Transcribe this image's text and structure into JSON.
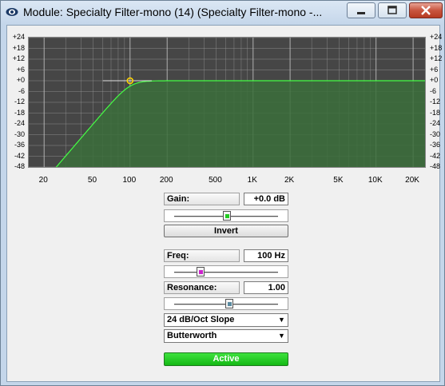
{
  "window": {
    "title": "Module: Specialty Filter-mono (14) (Specialty Filter-mono -...",
    "min_glyph": "—",
    "max_glyph": "□",
    "close_glyph": "✕"
  },
  "graph": {
    "db_labels": [
      "+24",
      "+18",
      "+12",
      "+6",
      "+0",
      "-6",
      "-12",
      "-18",
      "-24",
      "-30",
      "-36",
      "-42",
      "-48"
    ],
    "freq_labels": [
      "20",
      "50",
      "100",
      "200",
      "500",
      "1K",
      "2K",
      "5K",
      "10K",
      "20K"
    ],
    "colors": {
      "background": "#464646",
      "grid": "#9a9a9a",
      "fill": "#3b6e3b",
      "curve": "#44ff44",
      "handle": "#ffd400"
    }
  },
  "gain": {
    "label": "Gain:",
    "value": "+0.0 dB",
    "slider_fraction": 0.5,
    "thumb_color": "#22cc22"
  },
  "invert": {
    "label": "Invert"
  },
  "freq": {
    "label": "Freq:",
    "value": "100 Hz",
    "slider_fraction": 0.25,
    "thumb_color": "#cc22cc"
  },
  "resonance": {
    "label": "Resonance:",
    "value": "1.00",
    "slider_fraction": 0.52,
    "thumb_color": "#5a8aa0"
  },
  "slope": {
    "selected": "24 dB/Oct Slope"
  },
  "filter_type": {
    "selected": "Butterworth"
  },
  "active": {
    "label": "Active",
    "color": "#22cc22"
  }
}
